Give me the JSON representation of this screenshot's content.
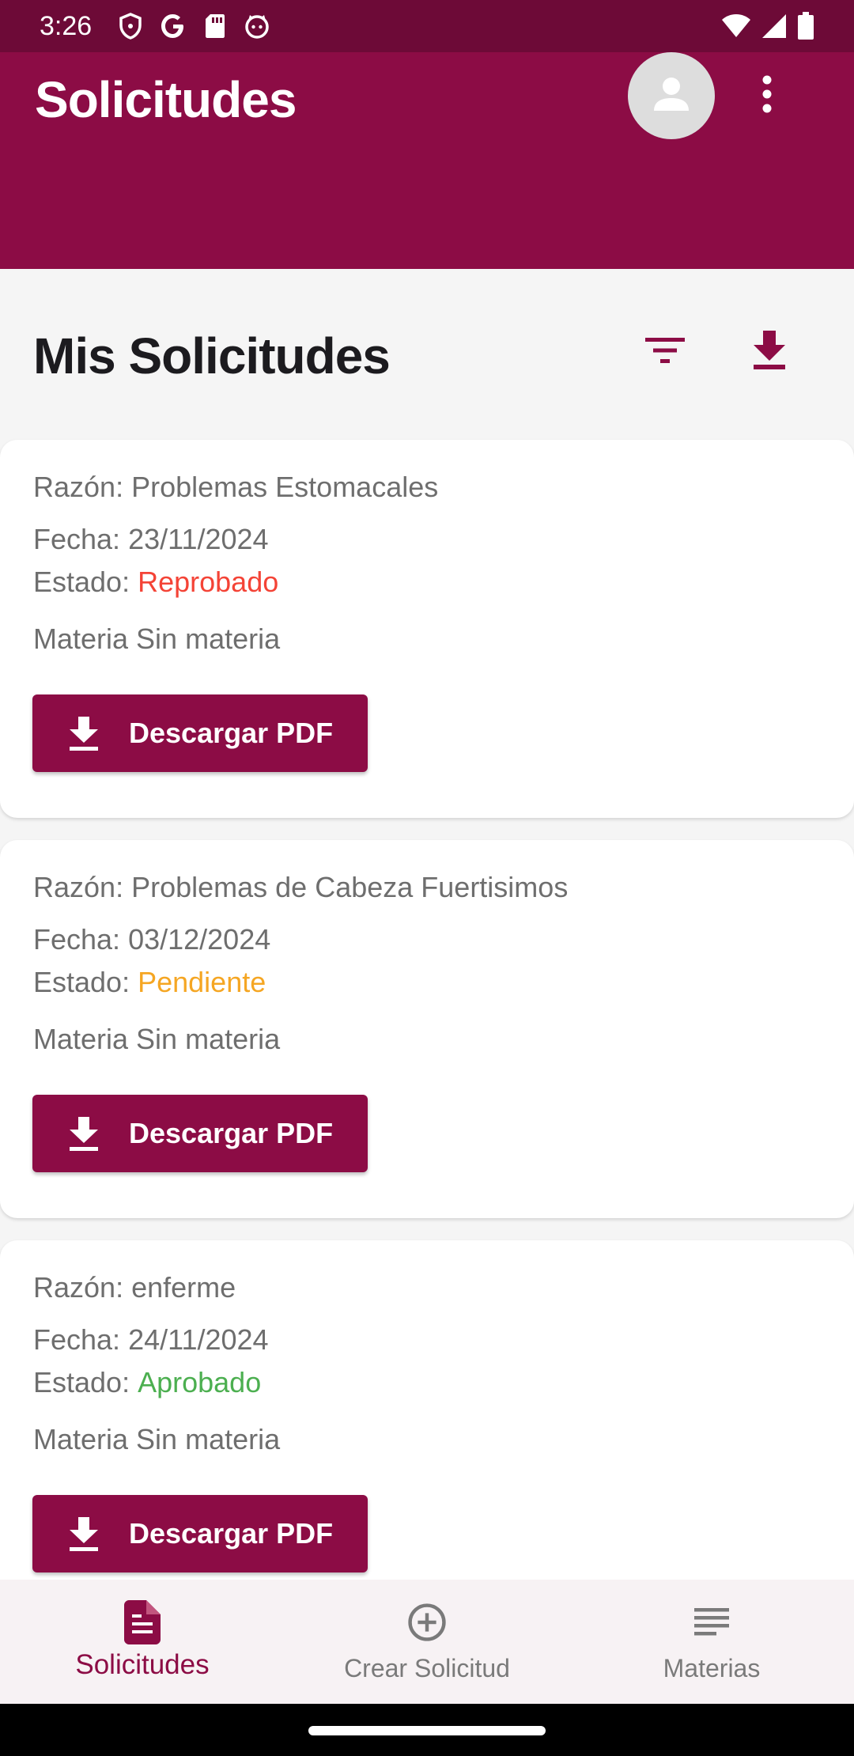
{
  "status_bar": {
    "time": "3:26",
    "left_icons": [
      "shield-icon",
      "google-icon",
      "sd-card-icon",
      "cat-icon"
    ],
    "right_icons": [
      "wifi-icon",
      "cell-signal-icon",
      "battery-icon"
    ]
  },
  "app_bar": {
    "title": "Solicitudes",
    "avatar_icon": "person-icon",
    "menu_icon": "more-vert-icon"
  },
  "section": {
    "title": "Mis Solicitudes",
    "filter_icon": "filter-icon",
    "download_icon": "download-icon"
  },
  "labels": {
    "reason": "Razón:",
    "date": "Fecha:",
    "status": "Estado:",
    "subject": "Materia",
    "pdf_button": "Descargar PDF"
  },
  "requests": [
    {
      "reason": "Problemas Estomacales",
      "date": "23/11/2024",
      "status": "Reprobado",
      "status_color": "#f44336",
      "subject": "Sin materia"
    },
    {
      "reason": "Problemas de Cabeza Fuertisimos",
      "date": "03/12/2024",
      "status": "Pendiente",
      "status_color": "#f5a623",
      "subject": "Sin materia"
    },
    {
      "reason": "enferme",
      "date": "24/11/2024",
      "status": "Aprobado",
      "status_color": "#4caf50",
      "subject": "Sin materia"
    }
  ],
  "bottom_nav": {
    "items": [
      {
        "label": "Solicitudes",
        "icon": "document-icon",
        "active": true
      },
      {
        "label": "Crear Solicitud",
        "icon": "add-circle-icon",
        "active": false
      },
      {
        "label": "Materias",
        "icon": "list-icon",
        "active": false
      }
    ]
  },
  "colors": {
    "primary": "#8c0c45",
    "status_bar": "#6d0a37",
    "background": "#f5f5f5"
  }
}
